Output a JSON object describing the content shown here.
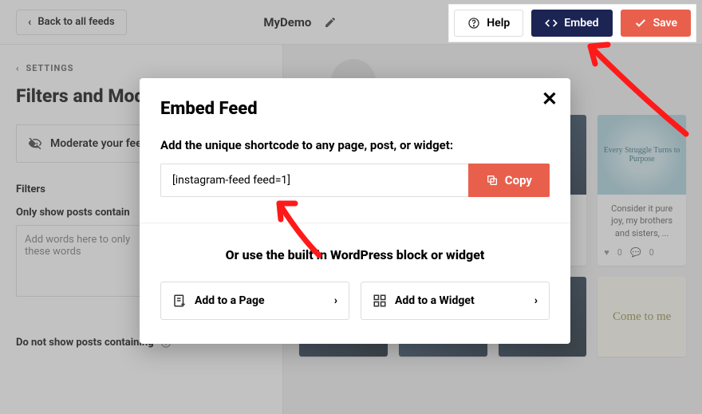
{
  "topbar": {
    "back_label": "Back to all feeds",
    "feed_name": "MyDemo",
    "help_label": "Help",
    "embed_label": "Embed",
    "save_label": "Save"
  },
  "sidebar": {
    "settings_link": "SETTINGS",
    "heading": "Filters and Mod",
    "moderate_label": "Moderate your fee",
    "filters_section": "Filters",
    "only_show_label": "Only show posts contain",
    "only_show_placeholder": "Add words here to only\nthese words",
    "do_not_show_label": "Do not show posts containing"
  },
  "preview": {
    "cards": [
      {
        "caption": ""
      },
      {
        "thumb_text": "Every Struggle Turns to Purpose",
        "caption": "Consider it pure joy, my brothers and sisters, ...",
        "likes": "0",
        "comments": "0"
      },
      {
        "caption": ""
      },
      {
        "thumb_text": "Come to me"
      }
    ]
  },
  "modal": {
    "title": "Embed Feed",
    "subtitle": "Add the unique shortcode to any page, post, or widget:",
    "shortcode": "[instagram-feed feed=1]",
    "copy_label": "Copy",
    "or_line": "Or use the built in WordPress block or widget",
    "add_page_label": "Add to a Page",
    "add_widget_label": "Add to a Widget"
  }
}
